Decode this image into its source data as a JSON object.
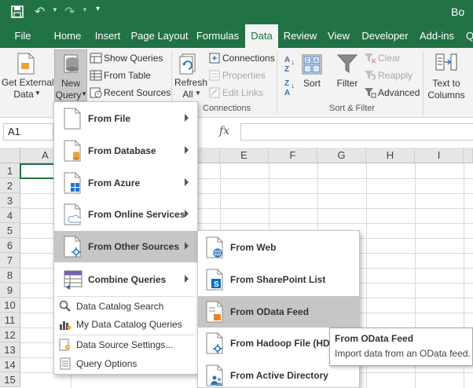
{
  "title": "Bo",
  "colors": {
    "accent": "#217346",
    "ribbon_bg": "#f3f3f3",
    "highlight": "#c6c6c6"
  },
  "tabs": [
    "File",
    "Home",
    "Insert",
    "Page Layout",
    "Formulas",
    "Data",
    "Review",
    "View",
    "Developer",
    "Add-ins",
    "Q"
  ],
  "active_tab": "Data",
  "ribbon": {
    "get_external_data": {
      "line1": "Get External",
      "line2": "Data"
    },
    "new_query": {
      "line1": "New",
      "line2": "Query"
    },
    "show_queries": "Show Queries",
    "from_table": "From Table",
    "recent_sources": "Recent Sources",
    "refresh_all": {
      "line1": "Refresh",
      "line2": "All"
    },
    "connections": "Connections",
    "properties": "Properties",
    "edit_links": "Edit Links",
    "connections_group": "Connections",
    "sort_az_top": "A",
    "sort_az_bottom": "Z",
    "sort_za_top": "Z",
    "sort_za_bottom": "A",
    "sort": "Sort",
    "filter": "Filter",
    "clear": "Clear",
    "reapply": "Reapply",
    "advanced": "Advanced",
    "sort_filter_group": "Sort & Filter",
    "text_to_columns": {
      "line1": "Text to",
      "line2": "Columns"
    }
  },
  "formula_bar": {
    "name_box": "A1",
    "fx": "fx"
  },
  "grid": {
    "columns": [
      "A",
      "E",
      "F",
      "G",
      "H",
      "I"
    ],
    "rows": [
      "1",
      "2",
      "3",
      "4",
      "5",
      "6",
      "7",
      "8",
      "9",
      "10",
      "11",
      "12",
      "13",
      "14",
      "15"
    ]
  },
  "menu": {
    "items": [
      {
        "label": "From File",
        "u": "F"
      },
      {
        "label": "From Database"
      },
      {
        "label": "From Azure"
      },
      {
        "label": "From Online Services"
      },
      {
        "label": "From Other Sources"
      },
      {
        "label": "Combine Queries"
      }
    ],
    "small_items": [
      "Data Catalog Search",
      "My Data Catalog Queries",
      "Data Source Settings...",
      "Query Options"
    ]
  },
  "submenu": {
    "items": [
      "From Web",
      "From SharePoint List",
      "From OData Feed",
      "From Hadoop File (HDFS)",
      "From Active Directory"
    ]
  },
  "tooltip": {
    "title": "From OData Feed",
    "description": "Import data from an OData feed."
  }
}
